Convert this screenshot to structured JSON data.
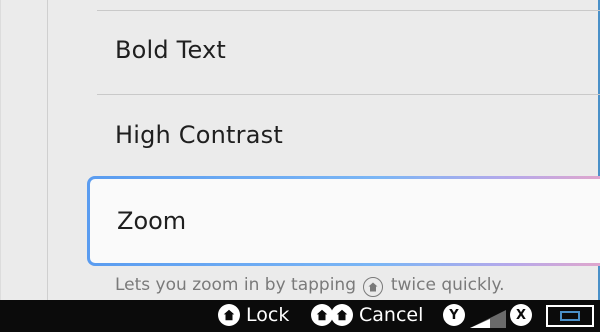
{
  "settings_list": {
    "items": [
      {
        "label": "Bold Text"
      },
      {
        "label": "High Contrast"
      },
      {
        "label": "Zoom",
        "selected": true
      }
    ],
    "description_before": "Lets you zoom in by tapping",
    "description_icon": "home-icon",
    "description_after": "twice quickly."
  },
  "bottom_bar": {
    "lock_label": "Lock",
    "cancel_label": "Cancel",
    "y_button": "Y",
    "x_button": "X",
    "icons": [
      "home-icon",
      "home-home-icon",
      "y-button-icon",
      "signal-icon",
      "x-button-icon",
      "battery-icon"
    ]
  },
  "colors": {
    "background": "#ebebeb",
    "selected_border_start": "#5a9cf0",
    "selected_border_end": "#e7a6c7",
    "bottom_bar": "#0b0b0b"
  }
}
